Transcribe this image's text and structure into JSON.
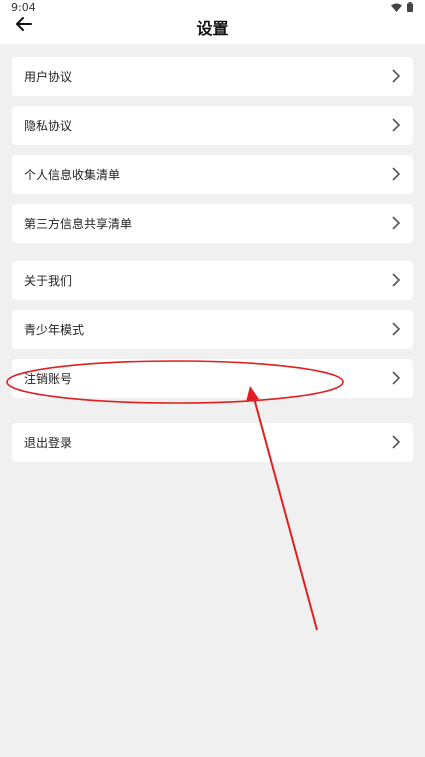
{
  "status_bar": {
    "time": "9:04",
    "icons": [
      "wifi-icon",
      "battery-icon"
    ]
  },
  "header": {
    "back_icon": "back-arrow-icon",
    "title": "设置"
  },
  "menu": {
    "items": [
      {
        "label": "用户协议"
      },
      {
        "label": "隐私协议"
      },
      {
        "label": "个人信息收集清单"
      },
      {
        "label": "第三方信息共享清单"
      },
      {
        "label": "关于我们"
      },
      {
        "label": "青少年模式"
      },
      {
        "label": "注销账号"
      },
      {
        "label": "退出登录"
      }
    ]
  },
  "annotation": {
    "color": "#e02020",
    "highlight": "注销账号"
  },
  "colors": {
    "page_background": "#f0f0f0",
    "card_background": "#ffffff",
    "chevron": "#555555"
  }
}
